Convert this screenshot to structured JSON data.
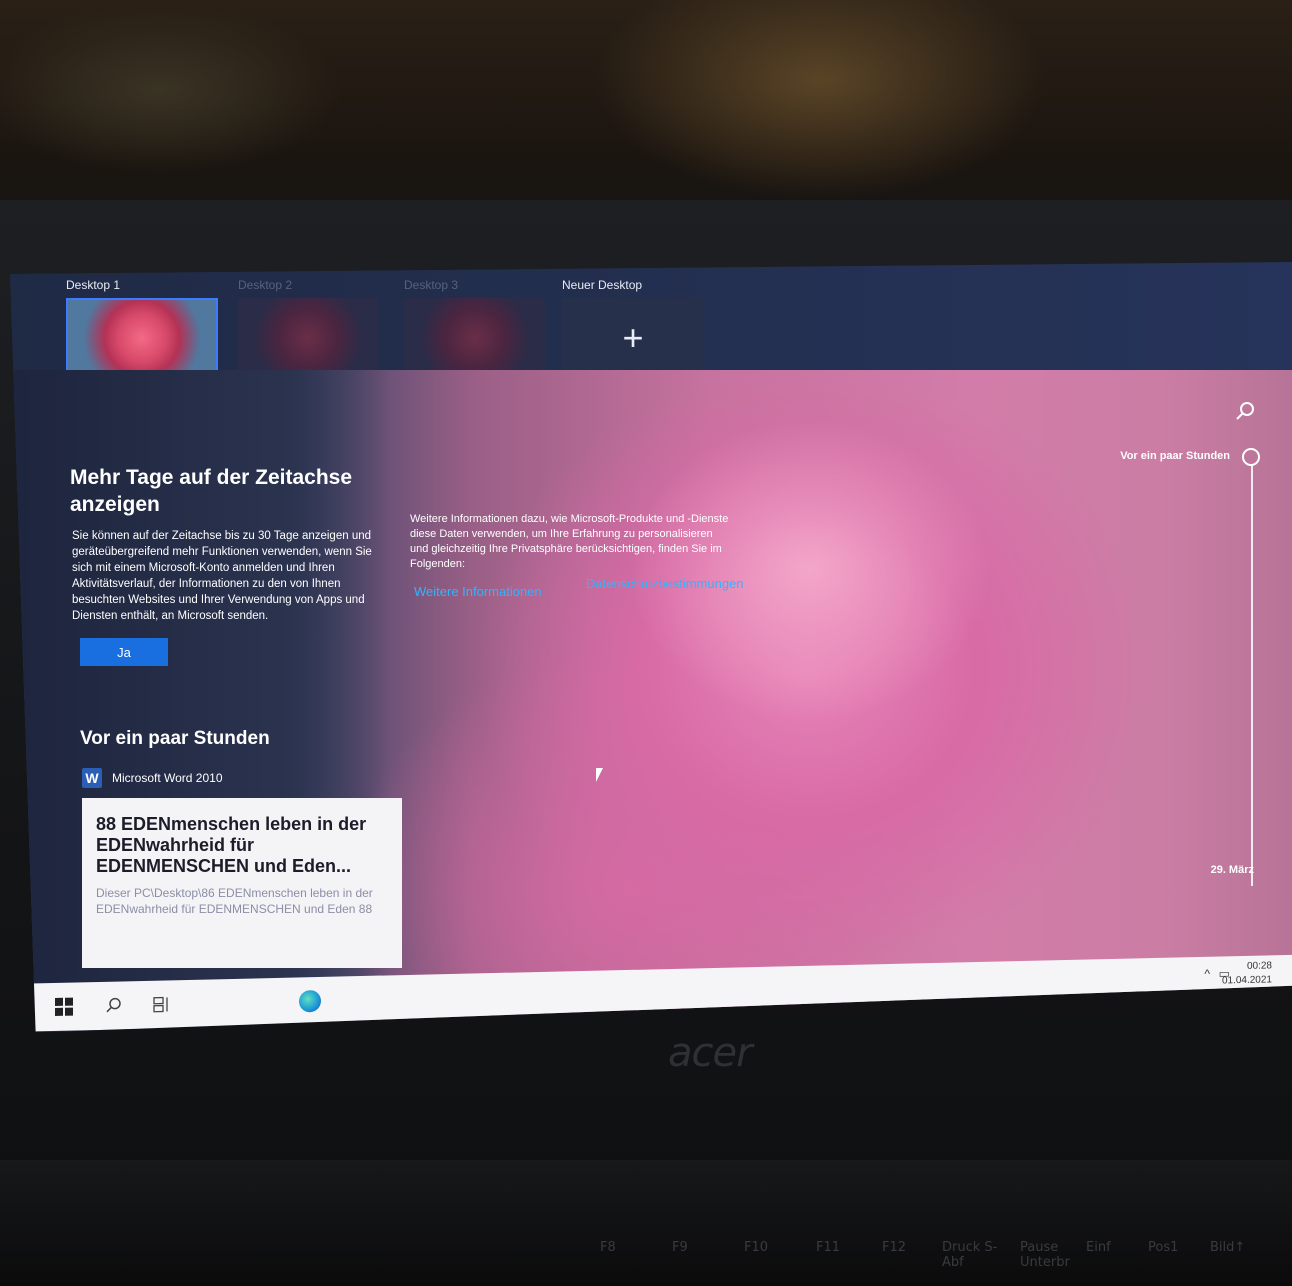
{
  "desktops": [
    {
      "label": "Desktop 1",
      "active": true
    },
    {
      "label": "Desktop 2",
      "active": false
    },
    {
      "label": "Desktop 3",
      "active": false
    },
    {
      "label": "Neuer Desktop",
      "icon": "plus-icon"
    }
  ],
  "promo": {
    "title": "Mehr Tage auf der Zeitachse anzeigen",
    "text": "Sie können auf der Zeitachse bis zu 30 Tage anzeigen und geräteübergreifend mehr Funktionen verwenden, wenn Sie sich mit einem Microsoft-Konto anmelden und Ihren Aktivitätsverlauf, der Informationen zu den von Ihnen besuchten Websites und Ihrer Verwendung von Apps und Diensten enthält, an Microsoft senden.",
    "button": "Ja"
  },
  "info": {
    "text": "Weitere Informationen dazu, wie Microsoft-Produkte und -Dienste diese Daten verwenden, um Ihre Erfahrung zu personalisieren und gleichzeitig Ihre Privatsphäre berücksichtigen, finden Sie im Folgenden:",
    "link_more": "Weitere Informationen",
    "link_privacy": "Datenschutzbestimmungen"
  },
  "activity": {
    "section": "Vor ein paar Stunden",
    "app": "Microsoft Word 2010",
    "app_icon_letter": "W",
    "doc_title": "88 EDENmenschen leben in der EDENwahrheid für EDENMENSCHEN und Eden...",
    "doc_path": "Dieser PC\\Desktop\\86 EDENmenschen leben in der EDENwahrheid für EDENMENSCHEN und Eden 88"
  },
  "timeline": {
    "current_label": "Vor ein paar Stunden",
    "end_label": "29. März"
  },
  "taskbar": {
    "time": "00:28",
    "date": "01.04.2021",
    "tray_chevron": "^"
  },
  "device": {
    "brand": "acer",
    "fkeys": [
      "F8",
      "F9",
      "F10",
      "F11",
      "F12",
      "Druck S-Abf",
      "Pause Unterbr",
      "Einf",
      "Pos1",
      "Bild↑"
    ]
  },
  "colors": {
    "accent": "#1a6fe0",
    "link": "#2fb5ff"
  }
}
